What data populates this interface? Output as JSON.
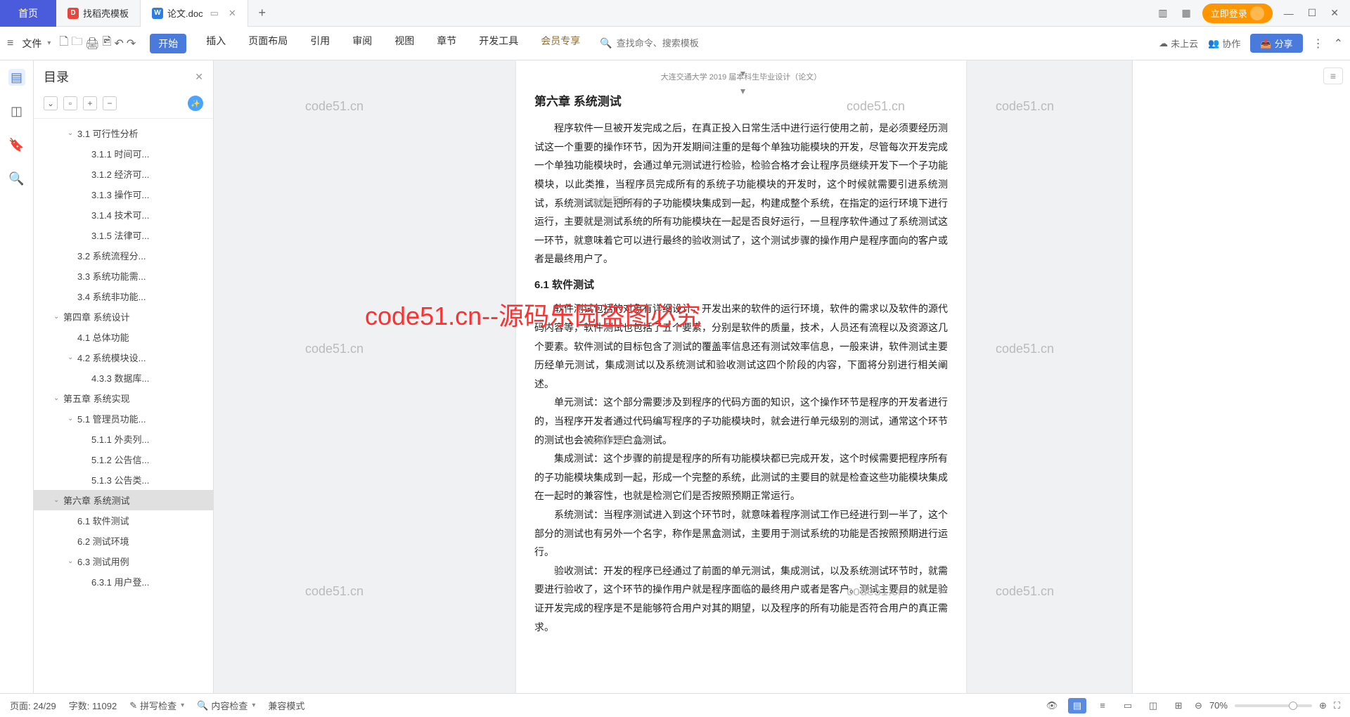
{
  "titlebar": {
    "home": "首页",
    "tab1": "找稻壳模板",
    "tab2": "论文.doc",
    "login": "立即登录"
  },
  "ribbon": {
    "file": "文件",
    "tabs": {
      "start": "开始",
      "insert": "插入",
      "layout": "页面布局",
      "ref": "引用",
      "review": "审阅",
      "view": "视图",
      "chapter": "章节",
      "dev": "开发工具",
      "vip": "会员专享"
    },
    "search_ph": "查找命令、搜索模板",
    "cloud": "未上云",
    "coop": "协作",
    "share": "分享"
  },
  "sidebar": {
    "title": "目录",
    "items": [
      {
        "lvl": 2,
        "exp": "v",
        "label": "3.1 可行性分析"
      },
      {
        "lvl": 3,
        "exp": "",
        "label": "3.1.1 时间可..."
      },
      {
        "lvl": 3,
        "exp": "",
        "label": "3.1.2 经济可..."
      },
      {
        "lvl": 3,
        "exp": "",
        "label": "3.1.3 操作可..."
      },
      {
        "lvl": 3,
        "exp": "",
        "label": "3.1.4 技术可..."
      },
      {
        "lvl": 3,
        "exp": "",
        "label": "3.1.5 法律可..."
      },
      {
        "lvl": 2,
        "exp": "",
        "label": "3.2 系统流程分..."
      },
      {
        "lvl": 2,
        "exp": "",
        "label": "3.3 系统功能需..."
      },
      {
        "lvl": 2,
        "exp": "",
        "label": "3.4 系统非功能..."
      },
      {
        "lvl": 1,
        "exp": "v",
        "label": "第四章  系统设计"
      },
      {
        "lvl": 2,
        "exp": "",
        "label": "4.1 总体功能"
      },
      {
        "lvl": 2,
        "exp": "v",
        "label": "4.2  系统模块设..."
      },
      {
        "lvl": 3,
        "exp": "",
        "label": "4.3.3 数据库..."
      },
      {
        "lvl": 1,
        "exp": "v",
        "label": "第五章  系统实现"
      },
      {
        "lvl": 2,
        "exp": "v",
        "label": "5.1 管理员功能..."
      },
      {
        "lvl": 3,
        "exp": "",
        "label": "5.1.1 外卖列..."
      },
      {
        "lvl": 3,
        "exp": "",
        "label": "5.1.2 公告信..."
      },
      {
        "lvl": 3,
        "exp": "",
        "label": "5.1.3 公告类..."
      },
      {
        "lvl": 1,
        "exp": "v",
        "label": "第六章  系统测试",
        "sel": true
      },
      {
        "lvl": 2,
        "exp": "",
        "label": "6.1 软件测试"
      },
      {
        "lvl": 2,
        "exp": "",
        "label": "6.2 测试环境"
      },
      {
        "lvl": 2,
        "exp": "v",
        "label": "6.3 测试用例"
      },
      {
        "lvl": 3,
        "exp": "",
        "label": "6.3.1 用户登..."
      }
    ]
  },
  "doc": {
    "hdr": "大连交通大学 2019 届本科生毕业设计（论文）",
    "h1": "第六章  系统测试",
    "p1": "程序软件一旦被开发完成之后，在真正投入日常生活中进行运行使用之前，是必须要经历测试这一个重要的操作环节，因为开发期间注重的是每个单独功能模块的开发，尽管每次开发完成一个单独功能模块时，会通过单元测试进行检验，检验合格才会让程序员继续开发下一个子功能模块，以此类推，当程序员完成所有的系统子功能模块的开发时，这个时候就需要引进系统测试，系统测试就是把所有的子功能模块集成到一起，构建成整个系统，在指定的运行环境下进行运行，主要就是测试系统的所有功能模块在一起是否良好运行，一旦程序软件通过了系统测试这一环节，就意味着它可以进行最终的验收测试了，这个测试步骤的操作用户是程序面向的客户或者是最终用户了。",
    "h2": "6.1 软件测试",
    "p2": "软件测试包括的对象有详细设计，开发出来的软件的运行环境，软件的需求以及软件的源代码内容等，软件测试也包括了五个要素，分别是软件的质量，技术，人员还有流程以及资源这几个要素。软件测试的目标包含了测试的覆盖率信息还有测试效率信息，一般来讲，软件测试主要历经单元测试，集成测试以及系统测试和验收测试这四个阶段的内容，下面将分别进行相关阐述。",
    "p3": "单元测试：这个部分需要涉及到程序的代码方面的知识，这个操作环节是程序的开发者进行的，当程序开发者通过代码编写程序的子功能模块时，就会进行单元级别的测试，通常这个环节的测试也会被称作是白盒测试。",
    "p4": "集成测试：这个步骤的前提是程序的所有功能模块都已完成开发，这个时候需要把程序所有的子功能模块集成到一起，形成一个完整的系统，此测试的主要目的就是检查这些功能模块集成在一起时的兼容性，也就是检测它们是否按照预期正常运行。",
    "p5": "系统测试：当程序测试进入到这个环节时，就意味着程序测试工作已经进行到一半了，这个部分的测试也有另外一个名字，称作是黑盒测试，主要用于测试系统的功能是否按照预期进行运行。",
    "p6": "验收测试：开发的程序已经通过了前面的单元测试，集成测试，以及系统测试环节时，就需要进行验收了，这个环节的操作用户就是程序面临的最终用户或者是客户。测试主要目的就是验证开发完成的程序是不是能够符合用户对其的期望，以及程序的所有功能是否符合用户的真正需求。"
  },
  "watermarks": {
    "grey": "code51.cn",
    "red": "code51.cn--源码乐园盗图必究"
  },
  "status": {
    "page": "页面: 24/29",
    "words": "字数: 11092",
    "spell": "拼写检查",
    "content": "内容检查",
    "compat": "兼容模式",
    "zoom": "70%"
  }
}
